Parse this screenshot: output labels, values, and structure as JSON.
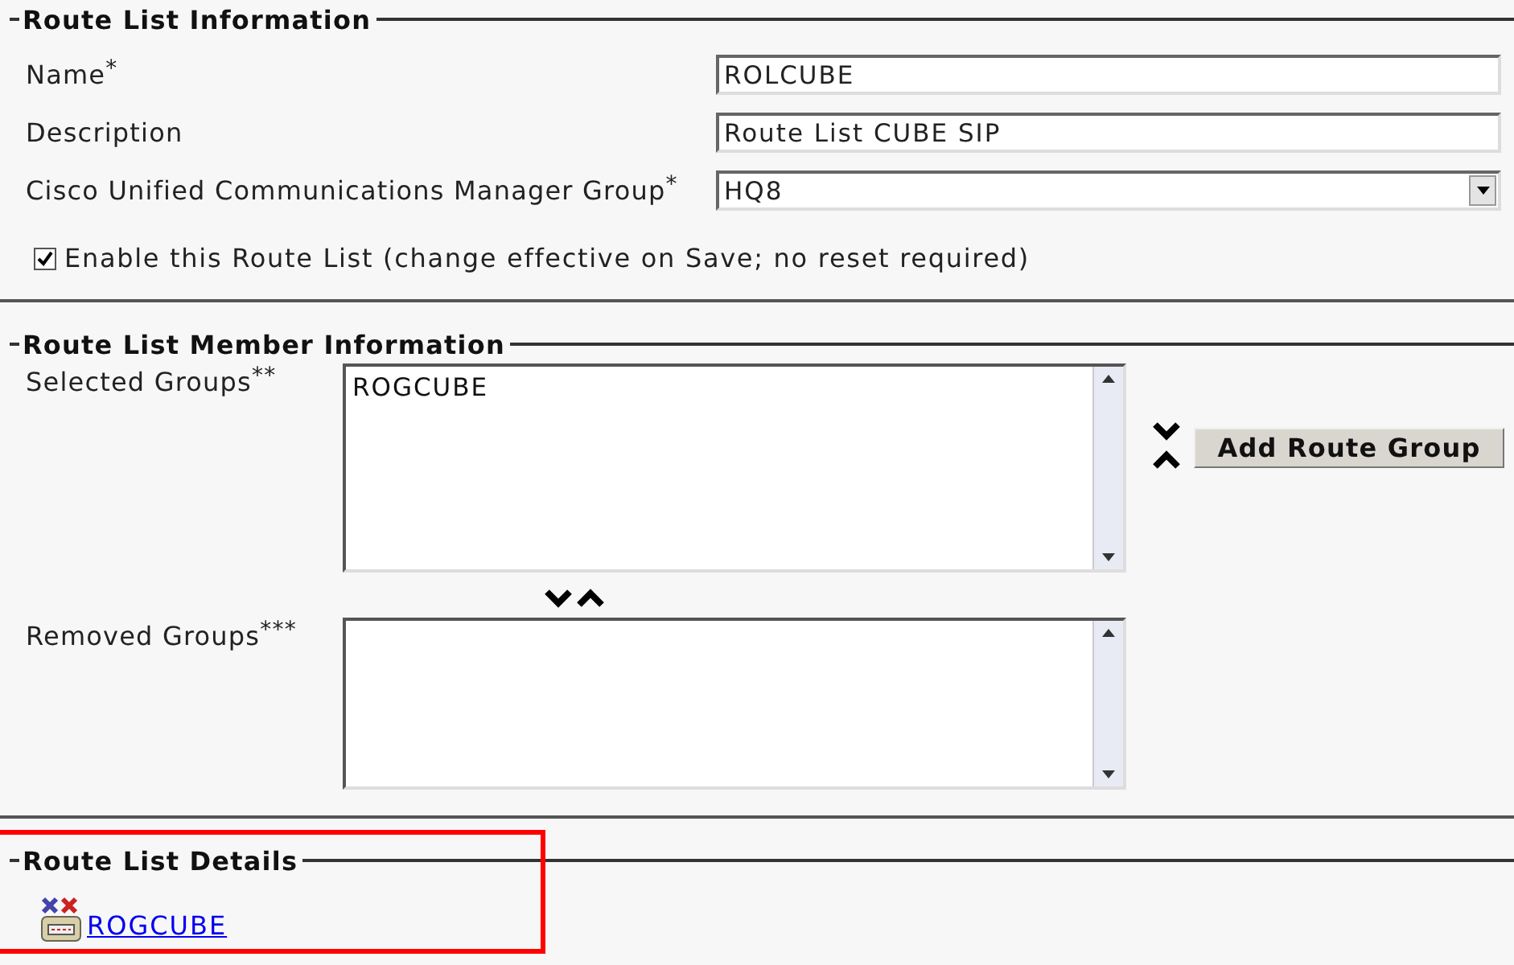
{
  "sections": [
    {
      "kind": "info",
      "title": "Route List Information",
      "fields": [
        {
          "kind": "text",
          "label": "Name$^{*}$",
          "value": "ROLCUBE"
        },
        {
          "kind": "text",
          "label": "Description",
          "value": "Route List CUBE SIP"
        },
        {
          "kind": "select",
          "label": "Cisco Unified Communications Manager Group$^{*}$",
          "value": "HQ8"
        }
      ],
      "checkbox": {
        "label": "Enable this Route List (change effective on Save; no reset required)",
        "checked": true
      }
    },
    {
      "kind": "members",
      "title": "Route List Member Information",
      "selected_groups": {
        "label": "Selected Groups$^{**}$",
        "items": [
          "ROGCUBE"
        ]
      },
      "button": "Add Route Group",
      "removed_groups": {
        "label": "Removed Groups$^{***}$"
      }
    },
    {
      "kind": "details",
      "title": "Route List Details",
      "highlighted": true,
      "links": [
        "ROGCUBE"
      ]
    }
  ]
}
